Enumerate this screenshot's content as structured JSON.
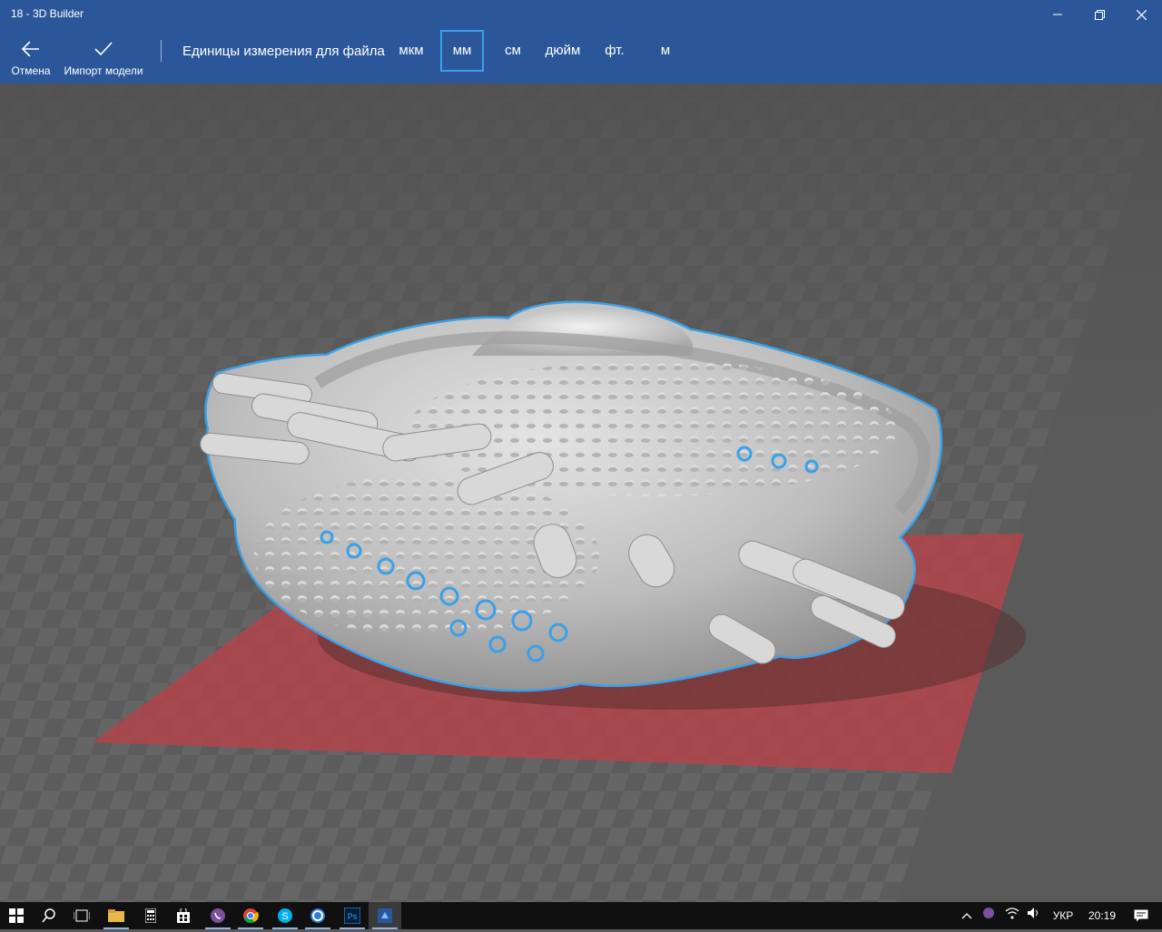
{
  "window": {
    "title": "18 - 3D Builder"
  },
  "toolbar": {
    "cancel_label": "Отмена",
    "import_label": "Импорт модели",
    "units_label": "Единицы измерения для файла",
    "units": [
      "мкм",
      "мм",
      "см",
      "дюйм",
      "фт.",
      "м"
    ],
    "selected_unit": "мм"
  },
  "taskbar": {
    "apps": [
      "start-icon",
      "search-icon",
      "task-view-icon",
      "file-explorer-icon",
      "calculator-icon",
      "store-icon",
      "viber-icon",
      "chrome-icon",
      "skype-icon",
      "app-icon",
      "photoshop-icon",
      "3d-builder-icon"
    ],
    "language": "УКР",
    "time": "20:19"
  },
  "colors": {
    "accent": "#2b579a",
    "selection": "#3aa0e8",
    "platform": "#b8444a"
  }
}
